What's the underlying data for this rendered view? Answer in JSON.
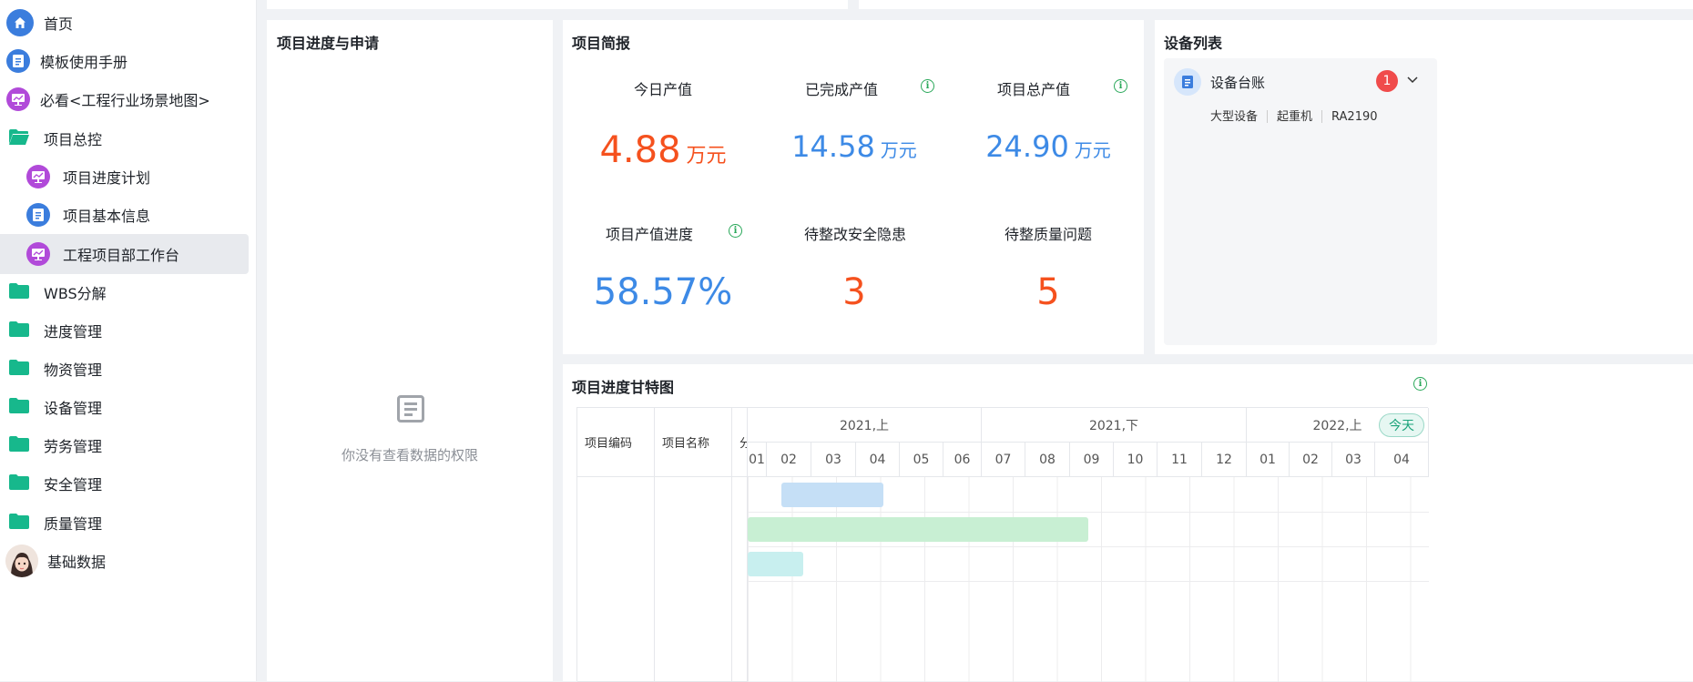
{
  "sidebar": {
    "items": [
      {
        "label": "首页",
        "icon": "home-icon"
      },
      {
        "label": "模板使用手册",
        "icon": "document-icon"
      },
      {
        "label": "必看<工程行业场景地图>",
        "icon": "presentation-icon"
      },
      {
        "label": "项目总控",
        "icon": "folder-open-icon"
      },
      {
        "label": "项目进度计划",
        "icon": "presentation-icon"
      },
      {
        "label": "项目基本信息",
        "icon": "document-icon"
      },
      {
        "label": "工程项目部工作台",
        "icon": "presentation-icon"
      },
      {
        "label": "WBS分解",
        "icon": "folder-icon"
      },
      {
        "label": "进度管理",
        "icon": "folder-icon"
      },
      {
        "label": "物资管理",
        "icon": "folder-icon"
      },
      {
        "label": "设备管理",
        "icon": "folder-icon"
      },
      {
        "label": "劳务管理",
        "icon": "folder-icon"
      },
      {
        "label": "安全管理",
        "icon": "folder-icon"
      },
      {
        "label": "质量管理",
        "icon": "folder-icon"
      },
      {
        "label": "基础数据",
        "icon": "avatar"
      }
    ]
  },
  "progress_panel": {
    "title": "项目进度与申请",
    "empty_text": "你没有查看数据的权限"
  },
  "summary_panel": {
    "title": "项目简报",
    "stats": [
      {
        "label": "今日产值",
        "value": "4.88",
        "unit": "万元"
      },
      {
        "label": "已完成产值",
        "value": "14.58",
        "unit": "万元"
      },
      {
        "label": "项目总产值",
        "value": "24.90",
        "unit": "万元"
      },
      {
        "label": "项目产值进度",
        "value": "58.57%"
      },
      {
        "label": "待整改安全隐患",
        "value": "3"
      },
      {
        "label": "待整质量问题",
        "value": "5"
      }
    ]
  },
  "device_panel": {
    "title": "设备列表",
    "item_title": "设备台账",
    "badge": "1",
    "tags": [
      "大型设备",
      "起重机",
      "RA2190"
    ]
  },
  "gantt": {
    "title": "项目进度甘特图",
    "today_label": "今天",
    "columns": [
      "项目编码",
      "项目名称",
      "分"
    ],
    "half_years": [
      "2021,上",
      "2021,下",
      "2022,上"
    ],
    "months": [
      "01",
      "02",
      "03",
      "04",
      "05",
      "06",
      "07",
      "08",
      "09",
      "10",
      "11",
      "12",
      "01",
      "02",
      "03",
      "04"
    ]
  },
  "colors": {
    "orange": "#f5511e",
    "blue": "#3d8ae6",
    "teal": "#17b88c",
    "purple": "#b14ad9"
  }
}
